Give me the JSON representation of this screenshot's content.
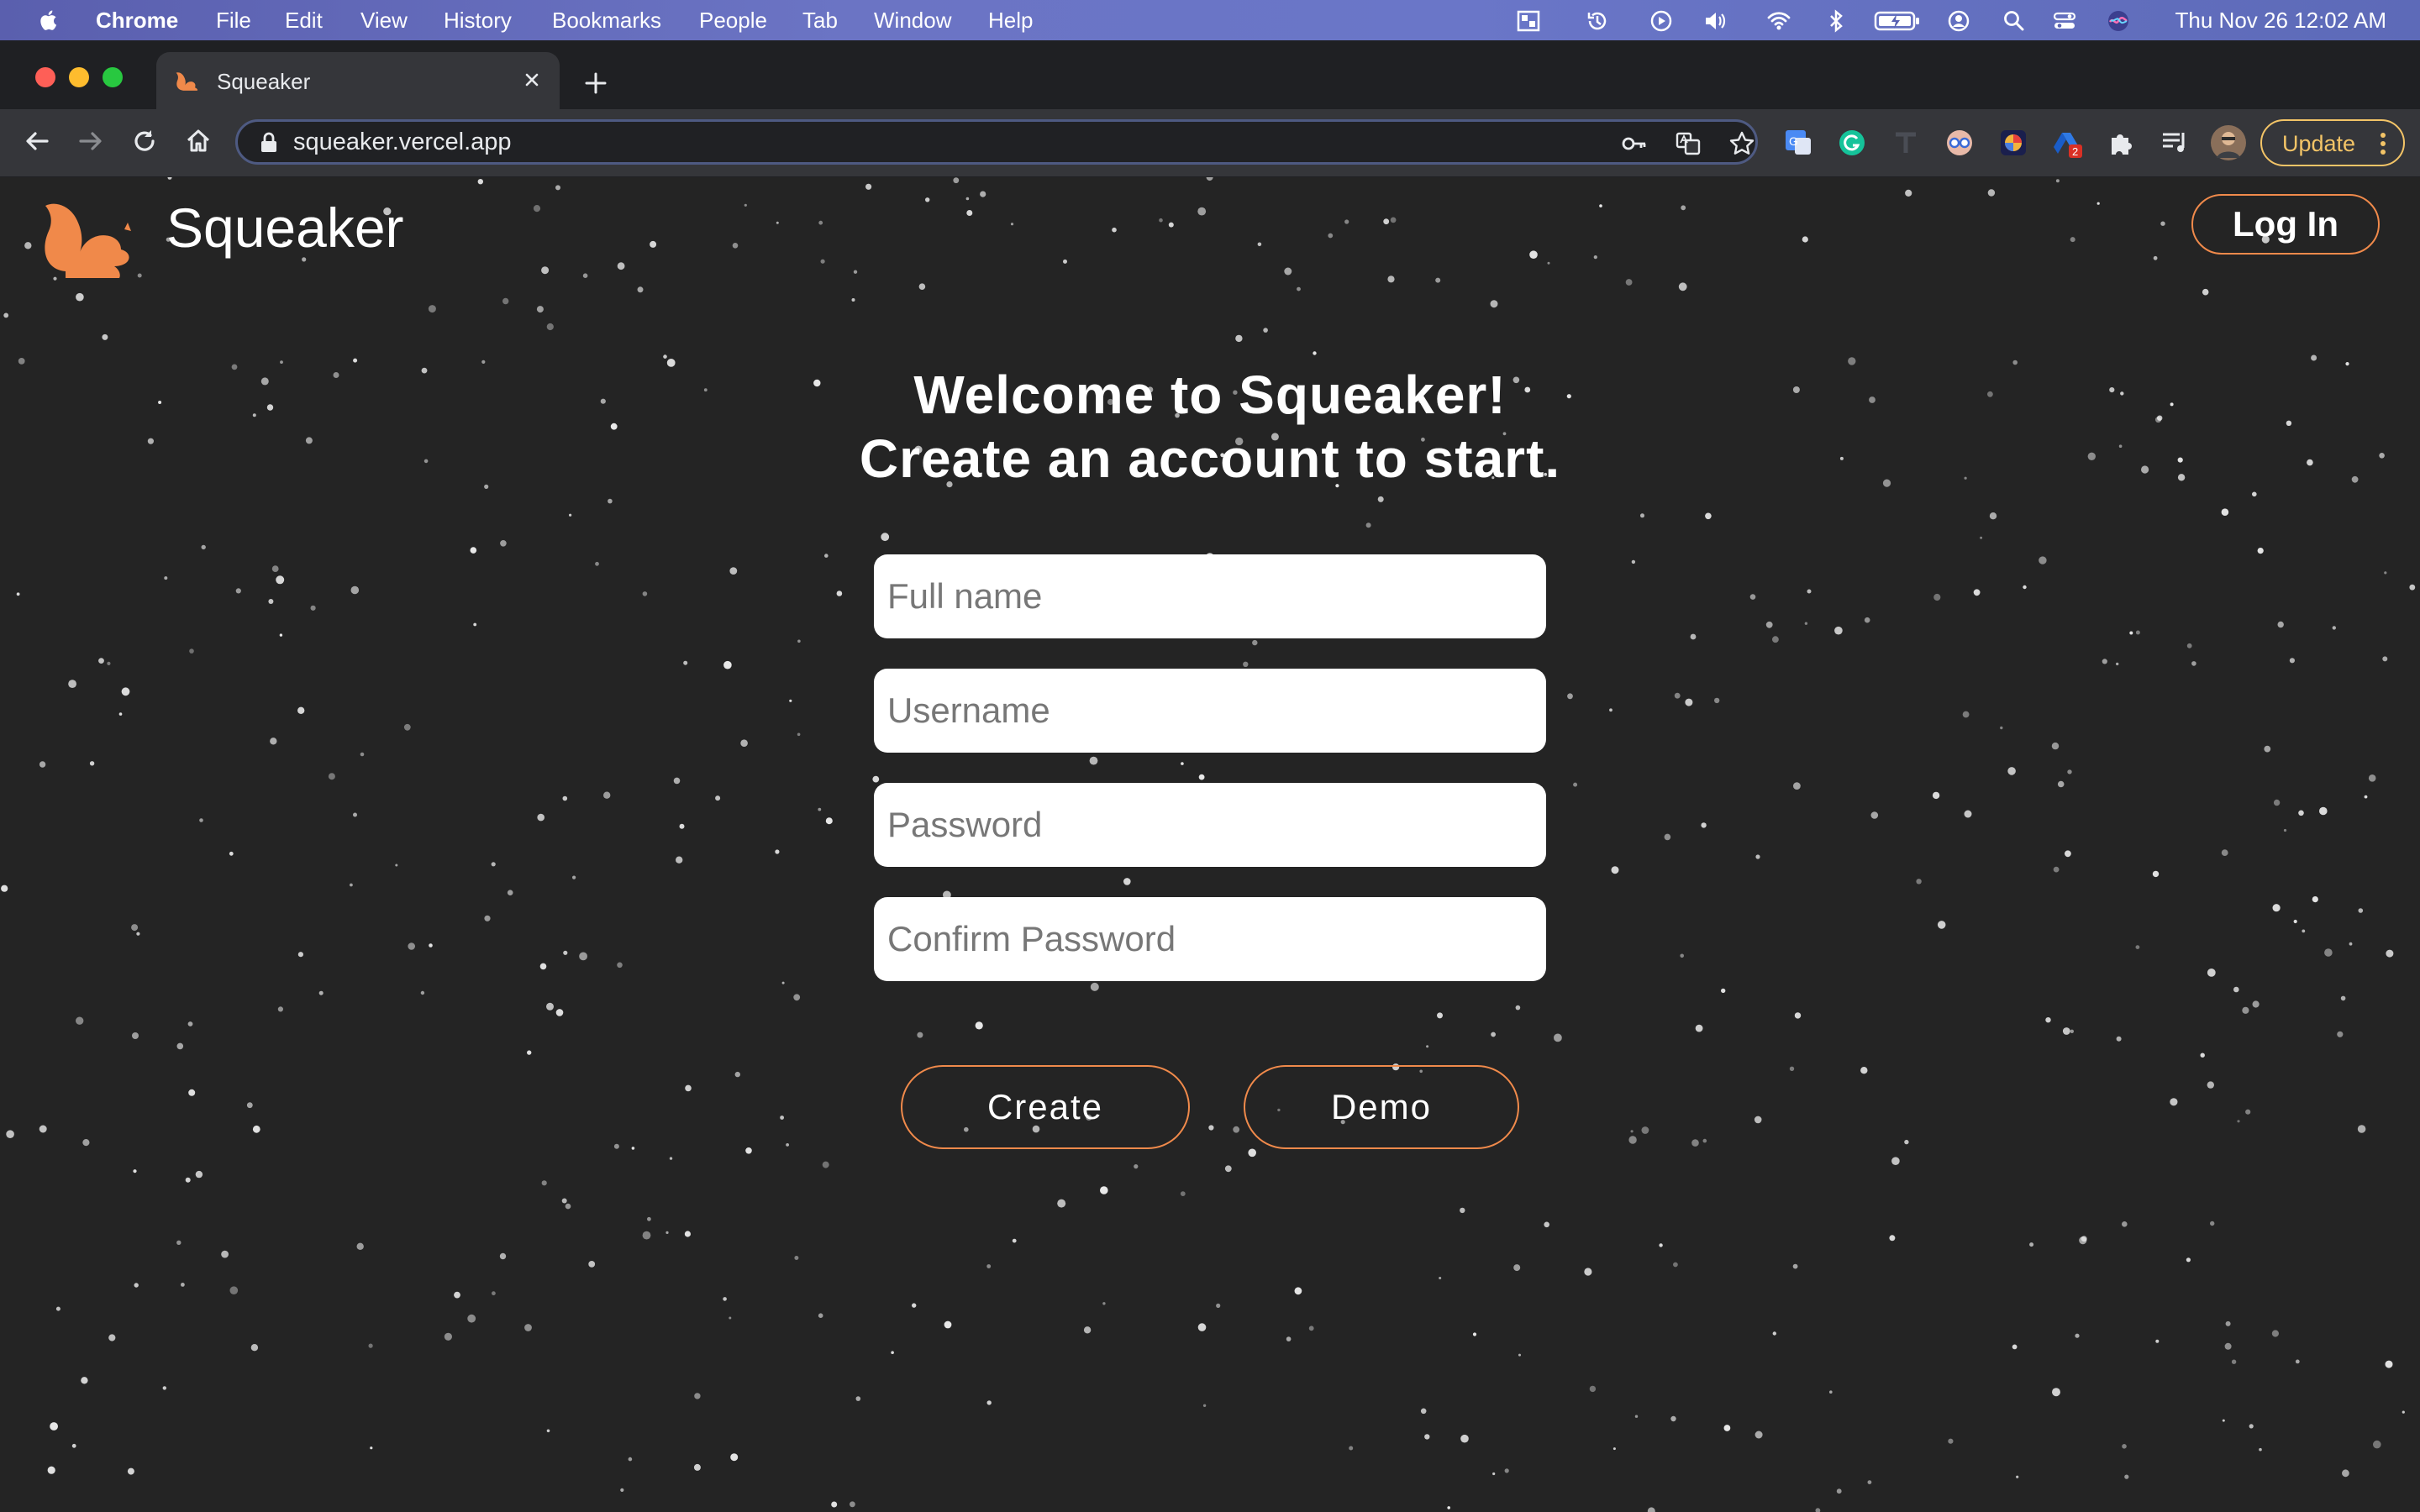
{
  "menubar": {
    "app_name": "Chrome",
    "items": [
      "File",
      "Edit",
      "View",
      "History",
      "Bookmarks",
      "People",
      "Tab",
      "Window",
      "Help"
    ],
    "clock": "Thu Nov 26  12:02 AM"
  },
  "browser": {
    "tab_title": "Squeaker",
    "url": "squeaker.vercel.app",
    "extension_badge": "2",
    "update_label": "Update"
  },
  "page": {
    "brand": "Squeaker",
    "login_label": "Log In",
    "headline_1": "Welcome to Squeaker!",
    "headline_2": "Create an account to start.",
    "fields": {
      "full_name": {
        "placeholder": "Full name",
        "value": ""
      },
      "username": {
        "placeholder": "Username",
        "value": ""
      },
      "password": {
        "placeholder": "Password",
        "value": ""
      },
      "confirm_password": {
        "placeholder": "Confirm Password",
        "value": ""
      }
    },
    "create_label": "Create",
    "demo_label": "Demo"
  },
  "colors": {
    "background": "#242424",
    "accent": "#f08a4b",
    "logo": "#f0894a",
    "update": "#f3c467"
  },
  "icons": {
    "apple": "apple-icon",
    "favicon": "squirrel-icon",
    "back": "back-arrow-icon",
    "forward": "forward-arrow-icon",
    "reload": "reload-icon",
    "home": "home-icon",
    "lock": "lock-icon",
    "key": "key-icon",
    "translate": "translate-icon",
    "bookmark": "star-icon",
    "extensions": "puzzle-icon",
    "reading_list": "reading-list-icon"
  }
}
